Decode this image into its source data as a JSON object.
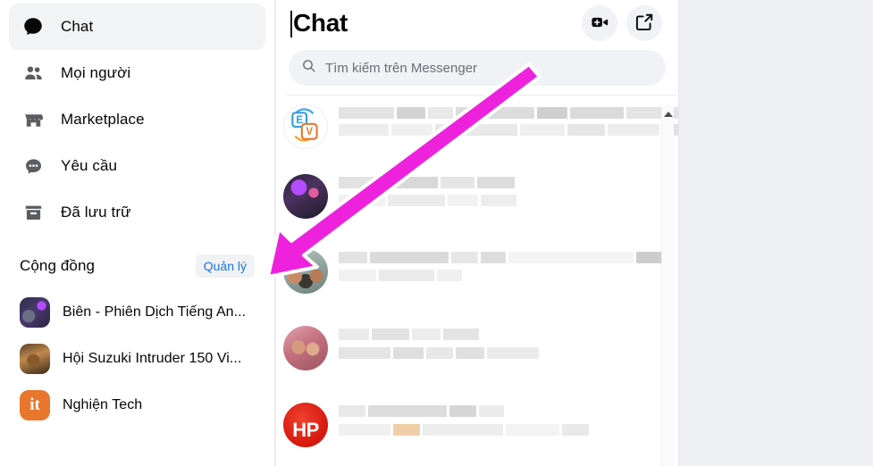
{
  "sidebar": {
    "items": [
      {
        "label": "Chat",
        "icon": "chat-bubble-icon",
        "active": true
      },
      {
        "label": "Mọi người",
        "icon": "people-icon",
        "active": false
      },
      {
        "label": "Marketplace",
        "icon": "storefront-icon",
        "active": false
      },
      {
        "label": "Yêu cầu",
        "icon": "message-dots-icon",
        "active": false
      },
      {
        "label": "Đã lưu trữ",
        "icon": "archive-box-icon",
        "active": false
      }
    ],
    "community": {
      "title": "Cộng đồng",
      "manage_label": "Quản lý",
      "groups": [
        {
          "name": "Biên - Phiên Dịch Tiếng An...",
          "avatar": "space-thumbnail"
        },
        {
          "name": "Hội Suzuki Intruder 150 Vi...",
          "avatar": "motorcycle-thumbnail"
        },
        {
          "name": "Nghiện Tech",
          "avatar": "orange-it-thumbnail",
          "initials": "it"
        }
      ]
    }
  },
  "chat_panel": {
    "title": "Chat",
    "video_call_label": "video-call",
    "compose_label": "new-message",
    "search": {
      "placeholder": "Tìm kiếm trên Messenger",
      "value": "",
      "icon": "search-icon"
    },
    "conversations": [
      {
        "avatar": "app-icons-thumbnail",
        "redacted": true
      },
      {
        "avatar": "gaming-photo-thumbnail",
        "redacted": true
      },
      {
        "avatar": "family-photo-thumbnail",
        "redacted": true
      },
      {
        "avatar": "couple-photo-thumbnail",
        "redacted": true
      },
      {
        "avatar": "hp-logo-thumbnail",
        "initials": "HP",
        "redacted": true
      }
    ],
    "scrollbar": {
      "arrow": "scroll-up-arrow"
    }
  },
  "annotation": {
    "arrow_color": "#EE22DD",
    "arrow_outline": "#ffffff",
    "points_to": "Quản lý"
  },
  "colors": {
    "accent_blue": "#1b74e4",
    "surface": "#ffffff",
    "hover_gray": "#f0f2f5",
    "page_bg": "#eef0f3",
    "text_primary": "#050505",
    "text_secondary": "#65676b"
  }
}
